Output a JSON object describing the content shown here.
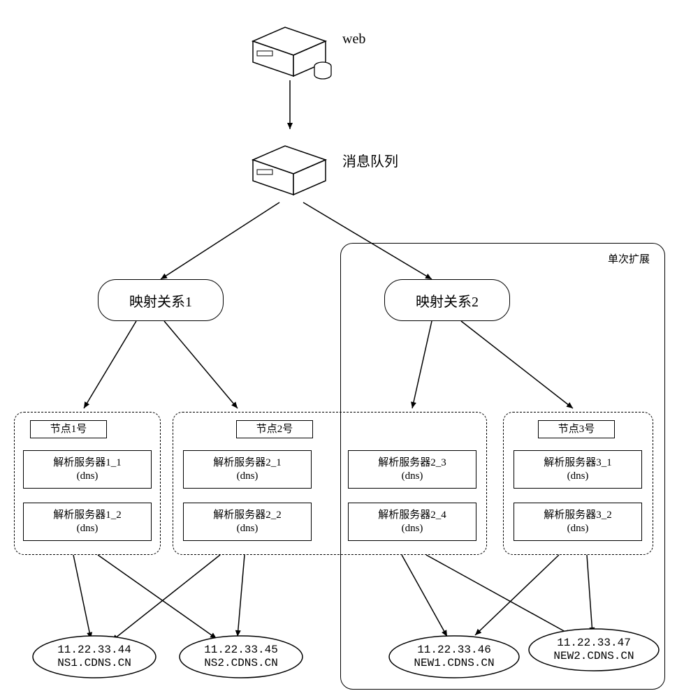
{
  "top": {
    "web_label": "web",
    "mq_label": "消息队列"
  },
  "mappings": {
    "m1": "映射关系1",
    "m2": "映射关系2"
  },
  "extension_label": "单次扩展",
  "nodes": {
    "n1": {
      "title": "节点1号",
      "servers": [
        "解析服务器1_1",
        "解析服务器1_2"
      ],
      "proto": "(dns)"
    },
    "n2a": {
      "title": "节点2号",
      "servers": [
        "解析服务器2_1",
        "解析服务器2_2"
      ],
      "proto": "(dns)"
    },
    "n2b": {
      "servers": [
        "解析服务器2_3",
        "解析服务器2_4"
      ],
      "proto": "(dns)"
    },
    "n3": {
      "title": "节点3号",
      "servers": [
        "解析服务器3_1",
        "解析服务器3_2"
      ],
      "proto": "(dns)"
    }
  },
  "endpoints": {
    "e1": {
      "ip": "11.22.33.44",
      "host": "NS1.CDNS.CN"
    },
    "e2": {
      "ip": "11.22.33.45",
      "host": "NS2.CDNS.CN"
    },
    "e3": {
      "ip": "11.22.33.46",
      "host": "NEW1.CDNS.CN"
    },
    "e4": {
      "ip": "11.22.33.47",
      "host": "NEW2.CDNS.CN"
    }
  }
}
